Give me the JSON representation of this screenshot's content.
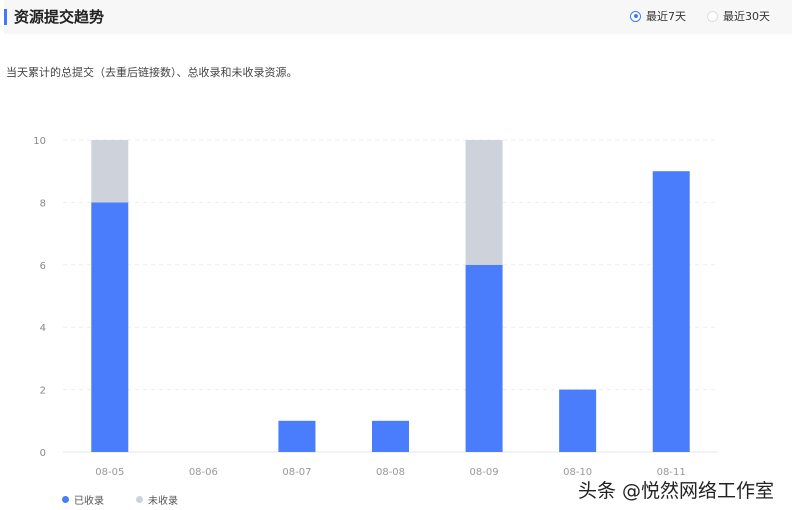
{
  "header": {
    "title": "资源提交趋势",
    "options": [
      {
        "label": "最近7天",
        "selected": true
      },
      {
        "label": "最近30天",
        "selected": false
      }
    ]
  },
  "description": "当天累计的总提交（去重后链接数）、总收录和未收录资源。",
  "watermark": "头条 @悦然网络工作室",
  "colors": {
    "indexed": "#4a7dfc",
    "unindexed": "#cdd2db"
  },
  "chart_data": {
    "type": "bar",
    "stacked": true,
    "categories": [
      "08-05",
      "08-06",
      "08-07",
      "08-08",
      "08-09",
      "08-10",
      "08-11"
    ],
    "series": [
      {
        "name": "已收录",
        "values": [
          8,
          0,
          1,
          1,
          6,
          2,
          9
        ]
      },
      {
        "name": "未收录",
        "values": [
          2,
          0,
          0,
          0,
          4,
          0,
          0
        ]
      }
    ],
    "ylim": [
      0,
      10
    ],
    "yticks": [
      0,
      2,
      4,
      6,
      8,
      10
    ],
    "grid": true,
    "legend": "bottom-left"
  }
}
